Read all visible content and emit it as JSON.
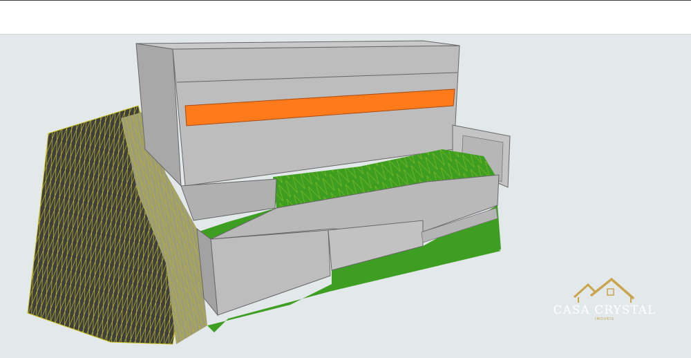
{
  "colors": {
    "background": "#e3e8ea",
    "wall": "#b3b3b3",
    "wall_light": "#c4c4c4",
    "terrain_green": "#3e9e22",
    "terrain_dark": "#3f3f3f",
    "mesh_yellow": "#c9c21e",
    "window_orange": "#ff7a1a",
    "logo_gold": "#c9a54e"
  },
  "viewport": {
    "content": "3d-model-building-on-terrain"
  },
  "logo": {
    "brand": "CASA CRYSTAL",
    "sub": "IMÓVEIS",
    "icon": "house-roof-icon"
  }
}
